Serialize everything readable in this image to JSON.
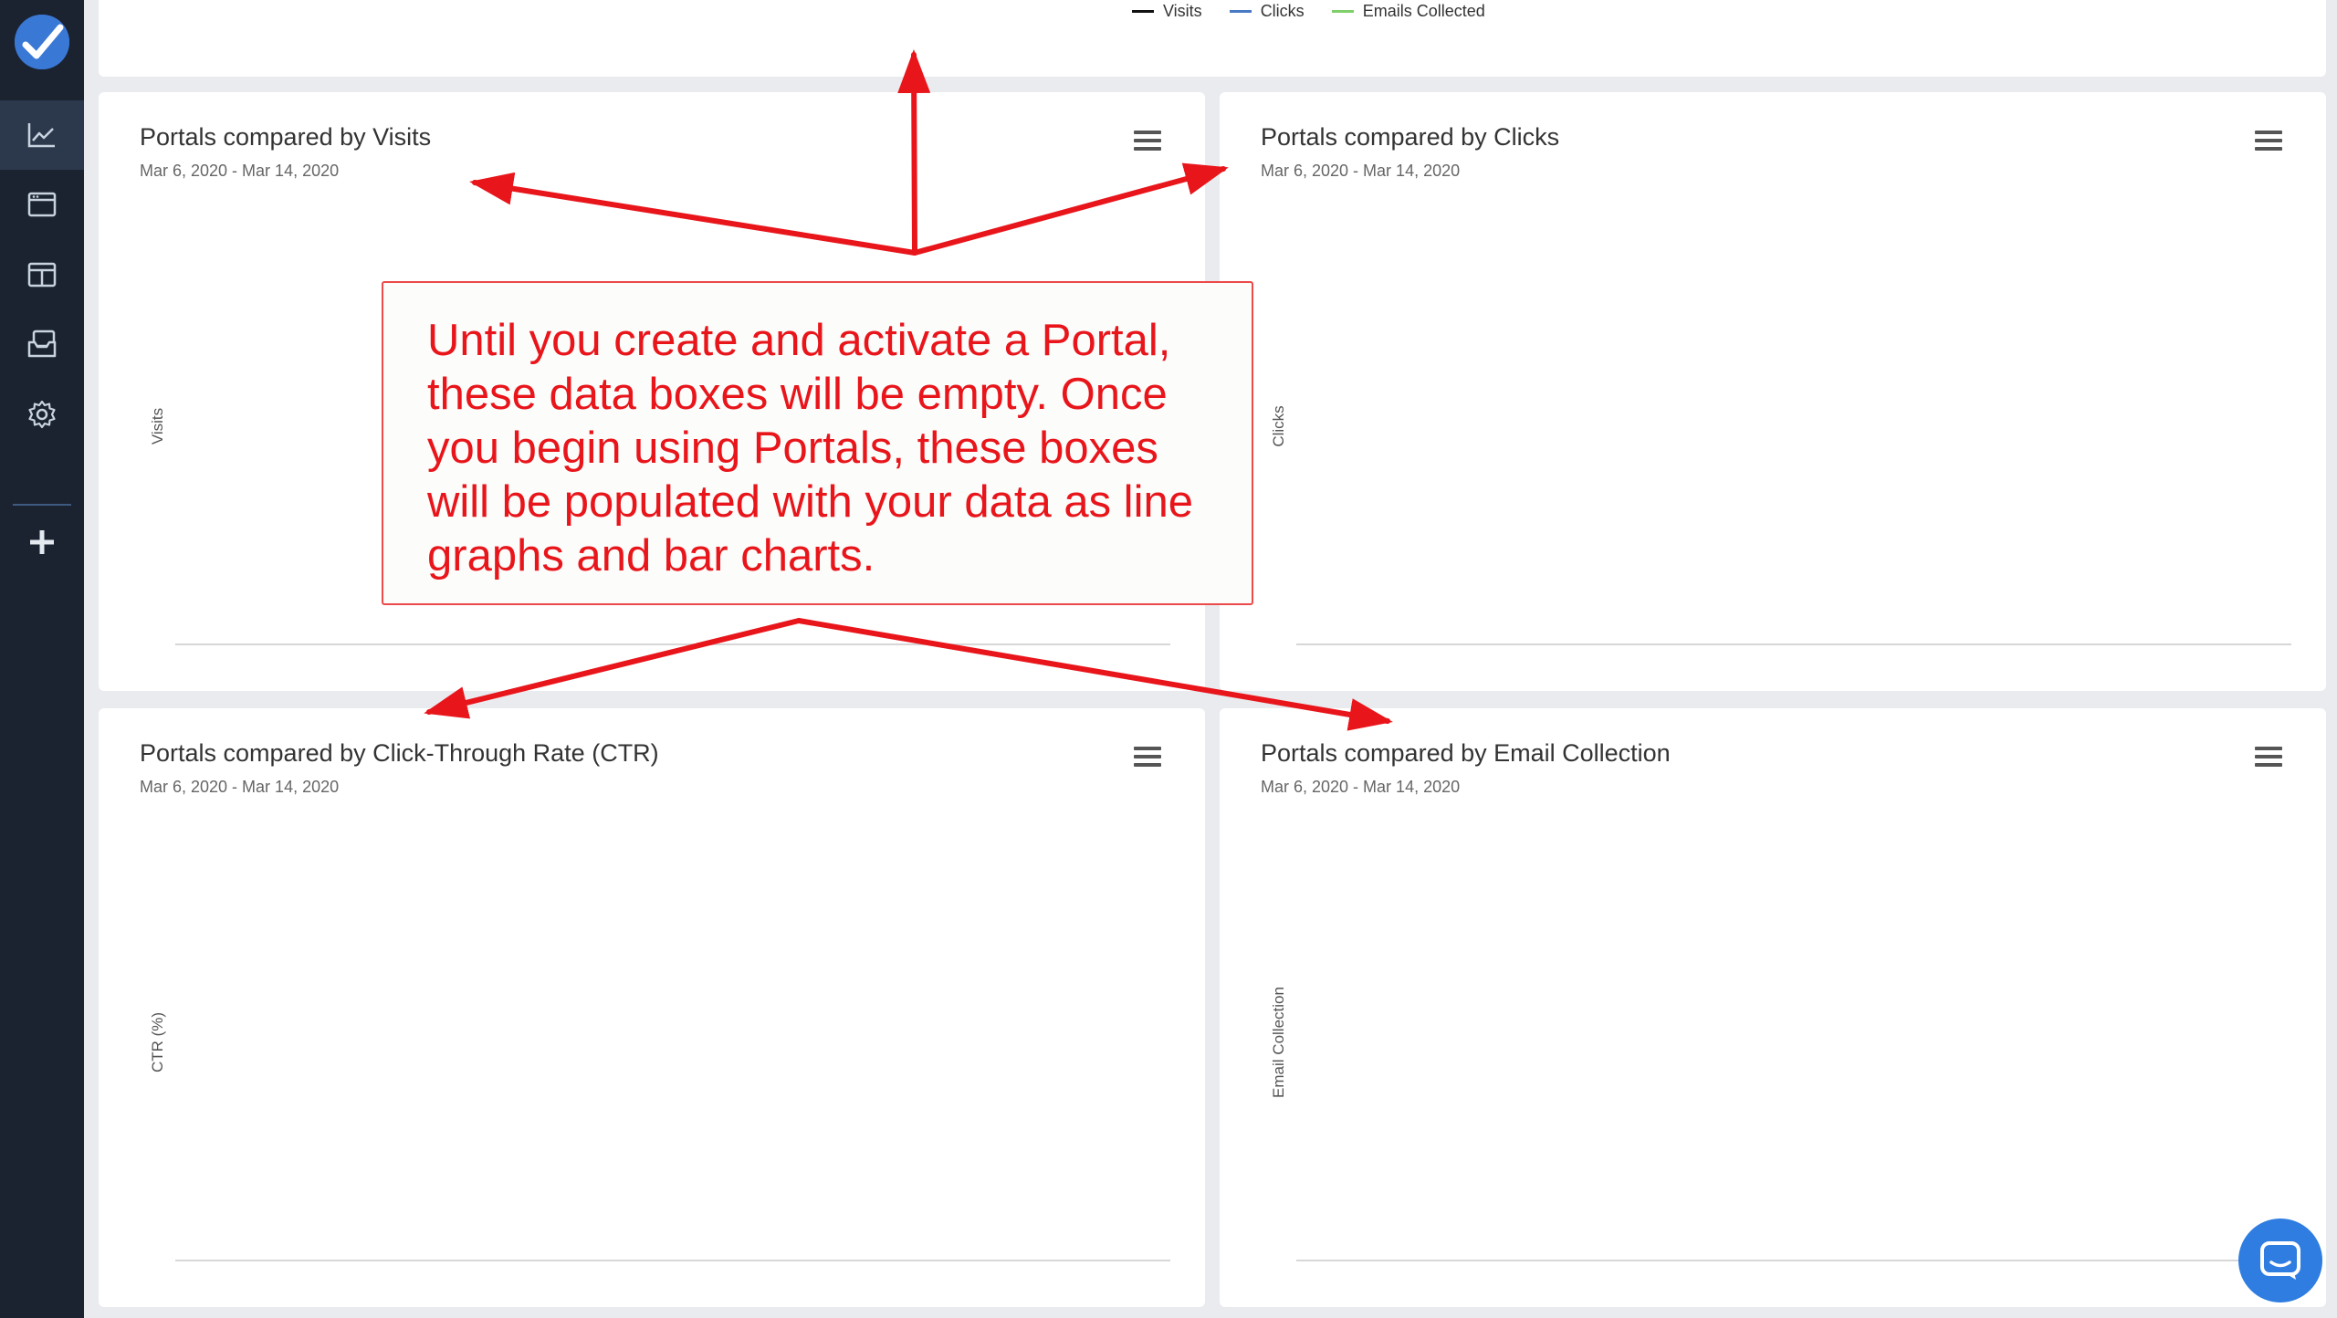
{
  "sidebar": {
    "items": [
      {
        "name": "analytics",
        "icon": "chart-line-icon",
        "active": true
      },
      {
        "name": "portals",
        "icon": "browser-window-icon",
        "active": false
      },
      {
        "name": "layouts",
        "icon": "columns-icon",
        "active": false
      },
      {
        "name": "inbox",
        "icon": "inbox-stack-icon",
        "active": false
      },
      {
        "name": "settings",
        "icon": "gear-icon",
        "active": false
      }
    ],
    "add_icon": "plus-icon"
  },
  "legend": {
    "items": [
      {
        "label": "Visits",
        "color": "#111111"
      },
      {
        "label": "Clicks",
        "color": "#4a79c4"
      },
      {
        "label": "Emails Collected",
        "color": "#7fcf6a"
      }
    ]
  },
  "charts": [
    {
      "title": "Portals compared by Visits",
      "date_range": "Mar 6, 2020 - Mar 14, 2020",
      "y_label": "Visits"
    },
    {
      "title": "Portals compared by Clicks",
      "date_range": "Mar 6, 2020 - Mar 14, 2020",
      "y_label": "Clicks"
    },
    {
      "title": "Portals compared by Click-Through Rate (CTR)",
      "date_range": "Mar 6, 2020 - Mar 14, 2020",
      "y_label": "CTR (%)"
    },
    {
      "title": "Portals compared by Email Collection",
      "date_range": "Mar 6, 2020 - Mar 14, 2020",
      "y_label": "Email Collection"
    }
  ],
  "annotation": {
    "text": "Until you create and activate a Portal, these data boxes will be empty. Once you begin using Portals, these boxes will be populated with your data as line graphs and bar charts."
  },
  "colors": {
    "sidebar_bg": "#1b2331",
    "accent": "#3a78d6",
    "annotation_red": "#e8151b",
    "chat_button": "#2f7de0"
  },
  "chat": {
    "icon": "chat-bubble-icon"
  }
}
